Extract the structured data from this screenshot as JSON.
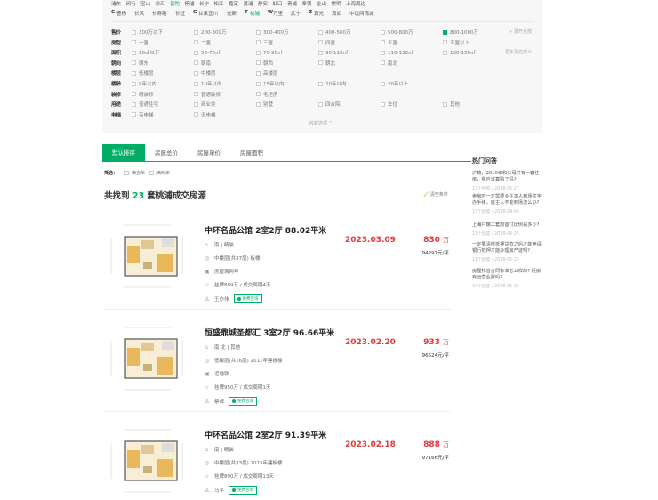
{
  "districts": {
    "row1": [
      "浦东",
      "闵行",
      "宝山",
      "徐汇",
      "普陀",
      "杨浦",
      "长宁",
      "松江",
      "嘉定",
      "黄浦",
      "静安",
      "虹口",
      "青浦",
      "奉贤",
      "金山",
      "崇明",
      "上海周边"
    ],
    "row1_active": "普陀",
    "row2": [
      {
        "letter": "C",
        "name": "曹杨"
      },
      {
        "name": "长风"
      },
      {
        "name": "长寿路"
      },
      {
        "name": "长征"
      },
      {
        "letter": "G",
        "name": "甘泉宜川"
      },
      {
        "name": "光新"
      },
      {
        "letter": "T",
        "name": "桃浦"
      },
      {
        "letter": "W",
        "name": "万里"
      },
      {
        "name": "武宁"
      },
      {
        "letter": "Z",
        "name": "真光"
      },
      {
        "name": "真如"
      },
      {
        "name": "中远两湾城"
      }
    ],
    "row2_active": "桃浦"
  },
  "filters": [
    {
      "label": "售价",
      "options": [
        "200万以下",
        "200-300万",
        "300-400万",
        "400-500万",
        "500-800万",
        "800-1000万"
      ],
      "checked": "800-1000万",
      "more": "+ 展开全部"
    },
    {
      "label": "房型",
      "options": [
        "一室",
        "二室",
        "三室",
        "四室",
        "五室",
        "五室以上"
      ]
    },
    {
      "label": "面积",
      "options": [
        "50㎡以下",
        "50-70㎡",
        "70-90㎡",
        "90-110㎡",
        "110-130㎡",
        "130-150㎡"
      ],
      "more": "+ 更多及自定义"
    },
    {
      "label": "朝向",
      "options": [
        "朝东",
        "朝南",
        "朝西",
        "朝北",
        "南北"
      ]
    },
    {
      "label": "楼层",
      "options": [
        "低楼层",
        "中楼层",
        "高楼层"
      ]
    },
    {
      "label": "楼龄",
      "options": [
        "5年以内",
        "10年以内",
        "15年以内",
        "20年以内",
        "20年以上"
      ]
    },
    {
      "label": "装修",
      "options": [
        "精装修",
        "普通装修",
        "毛坯房"
      ]
    },
    {
      "label": "用途",
      "options": [
        "普通住宅",
        "商业类",
        "别墅",
        "四合院",
        "车位",
        "其他"
      ]
    },
    {
      "label": "电梯",
      "options": [
        "有电梯",
        "无电梯"
      ]
    }
  ],
  "collapse_label": "收起选项 ^",
  "tabs": [
    "默认排序",
    "房屋总价",
    "房屋单价",
    "房屋面积"
  ],
  "screen": {
    "label": "筛选：",
    "options": [
      "满五年",
      "满两年"
    ]
  },
  "result": {
    "prefix": "共找到",
    "count": "23",
    "suffix": "套桃浦成交房源",
    "clear": "清空条件"
  },
  "listings": [
    {
      "title": "中环名品公馆 2室2厅 88.02平米",
      "house": "南 | 精装",
      "position": "中楼层(共37层) 板楼",
      "tag": "房屋满两年",
      "deal": "挂牌889万 / 成交周期4天",
      "agent": "王亦伟",
      "badge": "免费咨询",
      "date": "2023.03.09",
      "price": "830",
      "price_unit": "万",
      "unit_price": "94297元/平"
    },
    {
      "title": "恒盛鼎城圣都汇 3室2厅 96.66平米",
      "house": "南 北 | 其他",
      "position": "低楼层(共16层) 2011年建板楼",
      "tag": "近地铁",
      "deal": "挂牌950万 / 成交周期1天",
      "agent": "蔡诚",
      "badge": "免费咨询",
      "date": "2023.02.20",
      "price": "933",
      "price_unit": "万",
      "unit_price": "96524元/平"
    },
    {
      "title": "中环名品公馆 2室2厅 91.39平米",
      "house": "南 | 精装",
      "position": "中楼层(共33层) 2015年建板楼",
      "tag": null,
      "deal": "挂牌890万 / 成交周期13天",
      "agent": "马平",
      "badge": "免费咨询",
      "date": "2023.02.18",
      "price": "888",
      "price_unit": "万",
      "unit_price": "97166元/平"
    }
  ],
  "sidebar": {
    "title": "热门问答",
    "questions": [
      {
        "q": "沪籍，2010年和父母共有一套住房，我应该算购了吗?",
        "meta": "13个回答 / 2018-05-27"
      },
      {
        "q": "卖房时一定需要业主本人到场签字办手续，房主人不能到场怎么办?",
        "meta": "13个回答 / 2018-04-04"
      },
      {
        "q": "上海户籍二套房首付比例是多少?",
        "meta": "11个回答 / 2018-05-25"
      },
      {
        "q": "一定要清偿抵押贷款之后才能申请银行抵押才能办理房产证吗?",
        "meta": "11个回答 / 2018-05-25"
      },
      {
        "q": "房屋托管合同标准怎么样的? 租房有运营业费吗?",
        "meta": "10个回答 / 2018-05-25"
      }
    ]
  },
  "colors": {
    "brand": "#00ae66",
    "price": "#e4393c"
  }
}
